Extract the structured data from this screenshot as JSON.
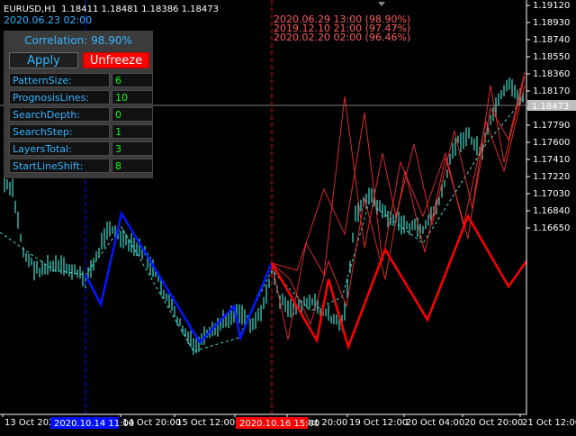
{
  "header": {
    "symbol": "EURUSD,H1",
    "ohlc": "1.18411 1.18481 1.18386 1.18473",
    "cursor_time": "2020.06.23 02:00"
  },
  "matches": [
    {
      "label": "2020.06.29 13:00 (98.90%)"
    },
    {
      "label": "2019.12.10 21:00 (97.47%)"
    },
    {
      "label": "2020.02.20 02:00 (96.46%)"
    }
  ],
  "panel": {
    "correlation": "Correlation: 98.90%",
    "apply_label": "Apply",
    "unfreeze_label": "Unfreeze",
    "params": [
      {
        "label": "PatternSize:",
        "value": "6"
      },
      {
        "label": "PrognosisLines:",
        "value": "10"
      },
      {
        "label": "SearchDepth:",
        "value": "0"
      },
      {
        "label": "SearchStep:",
        "value": "1"
      },
      {
        "label": "LayersTotal:",
        "value": "3"
      },
      {
        "label": "StartLineShift:",
        "value": "8"
      }
    ]
  },
  "colors": {
    "background": "#000000",
    "candles": "#40e0d0",
    "pattern": "#0018ff",
    "prognosis": "#ff0000",
    "axis_text": "#ffffff",
    "accent": "#34b4ff",
    "value_text": "#00ff00"
  },
  "chart_data": {
    "type": "line",
    "y_ticks": [
      "1.19120",
      "1.18930",
      "1.18740",
      "1.18550",
      "1.18360",
      "1.18170",
      "1.17980",
      "1.17790",
      "1.17600",
      "1.17410",
      "1.17220",
      "1.17030",
      "1.16840",
      "1.16650"
    ],
    "current_price": "1.18473",
    "x_ticks": [
      "13 Oct 2020",
      "14 Oct 20:00",
      "15 Oct 12:00",
      "16 Oct 04:00",
      "16 Oct 20:00",
      "19 Oct 12:00",
      "20 Oct 04:00",
      "20 Oct 20:00",
      "21 Oct 12:00"
    ],
    "pattern_start_label": "2020.10.14 11:00",
    "pattern_end_label": "2020.10.16 15:00"
  }
}
